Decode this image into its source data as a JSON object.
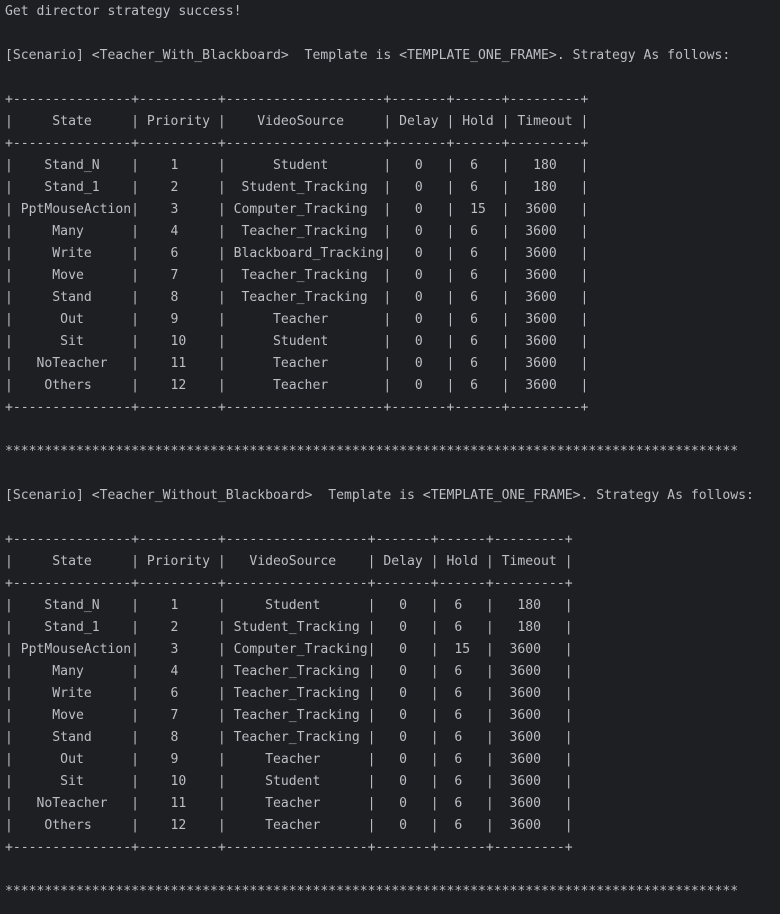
{
  "console": {
    "lines": [
      "Get director strategy success!",
      "",
      "[Scenario] <Teacher_With_Blackboard>  Template is <TEMPLATE_ONE_FRAME>. Strategy As follows:",
      "",
      "+---------------+----------+--------------------+-------+------+---------+",
      "|     State     | Priority |    VideoSource     | Delay | Hold | Timeout |",
      "+---------------+----------+--------------------+-------+------+---------+",
      "|    Stand_N    |    1     |      Student       |   0   |  6   |   180   |",
      "|    Stand_1    |    2     |  Student_Tracking  |   0   |  6   |   180   |",
      "| PptMouseAction|    3     | Computer_Tracking  |   0   |  15  |  3600   |",
      "|     Many      |    4     |  Teacher_Tracking  |   0   |  6   |  3600   |",
      "|     Write     |    6     | Blackboard_Tracking|   0   |  6   |  3600   |",
      "|     Move      |    7     |  Teacher_Tracking  |   0   |  6   |  3600   |",
      "|     Stand     |    8     |  Teacher_Tracking  |   0   |  6   |  3600   |",
      "|      Out      |    9     |      Teacher       |   0   |  6   |  3600   |",
      "|      Sit      |    10    |      Student       |   0   |  6   |  3600   |",
      "|   NoTeacher   |    11    |      Teacher       |   0   |  6   |  3600   |",
      "|    Others     |    12    |      Teacher       |   0   |  6   |  3600   |",
      "+---------------+----------+--------------------+-------+------+---------+",
      "",
      "*********************************************************************************************",
      "",
      "[Scenario] <Teacher_Without_Blackboard>  Template is <TEMPLATE_ONE_FRAME>. Strategy As follows:",
      "",
      "+---------------+----------+------------------+-------+------+---------+",
      "|     State     | Priority |   VideoSource    | Delay | Hold | Timeout |",
      "+---------------+----------+------------------+-------+------+---------+",
      "|    Stand_N    |    1     |     Student      |   0   |  6   |   180   |",
      "|    Stand_1    |    2     | Student_Tracking |   0   |  6   |   180   |",
      "| PptMouseAction|    3     | Computer_Tracking|   0   |  15  |  3600   |",
      "|     Many      |    4     | Teacher_Tracking |   0   |  6   |  3600   |",
      "|     Write     |    6     | Teacher_Tracking |   0   |  6   |  3600   |",
      "|     Move      |    7     | Teacher_Tracking |   0   |  6   |  3600   |",
      "|     Stand     |    8     | Teacher_Tracking |   0   |  6   |  3600   |",
      "|      Out      |    9     |     Teacher      |   0   |  6   |  3600   |",
      "|      Sit      |    10    |     Student      |   0   |  6   |  3600   |",
      "|   NoTeacher   |    11    |     Teacher      |   0   |  6   |  3600   |",
      "|    Others     |    12    |     Teacher      |   0   |  6   |  3600   |",
      "+---------------+----------+------------------+-------+------+---------+",
      "",
      "*********************************************************************************************"
    ]
  },
  "colors": {
    "background": "#1e1f22",
    "text": "#bcbec4"
  }
}
